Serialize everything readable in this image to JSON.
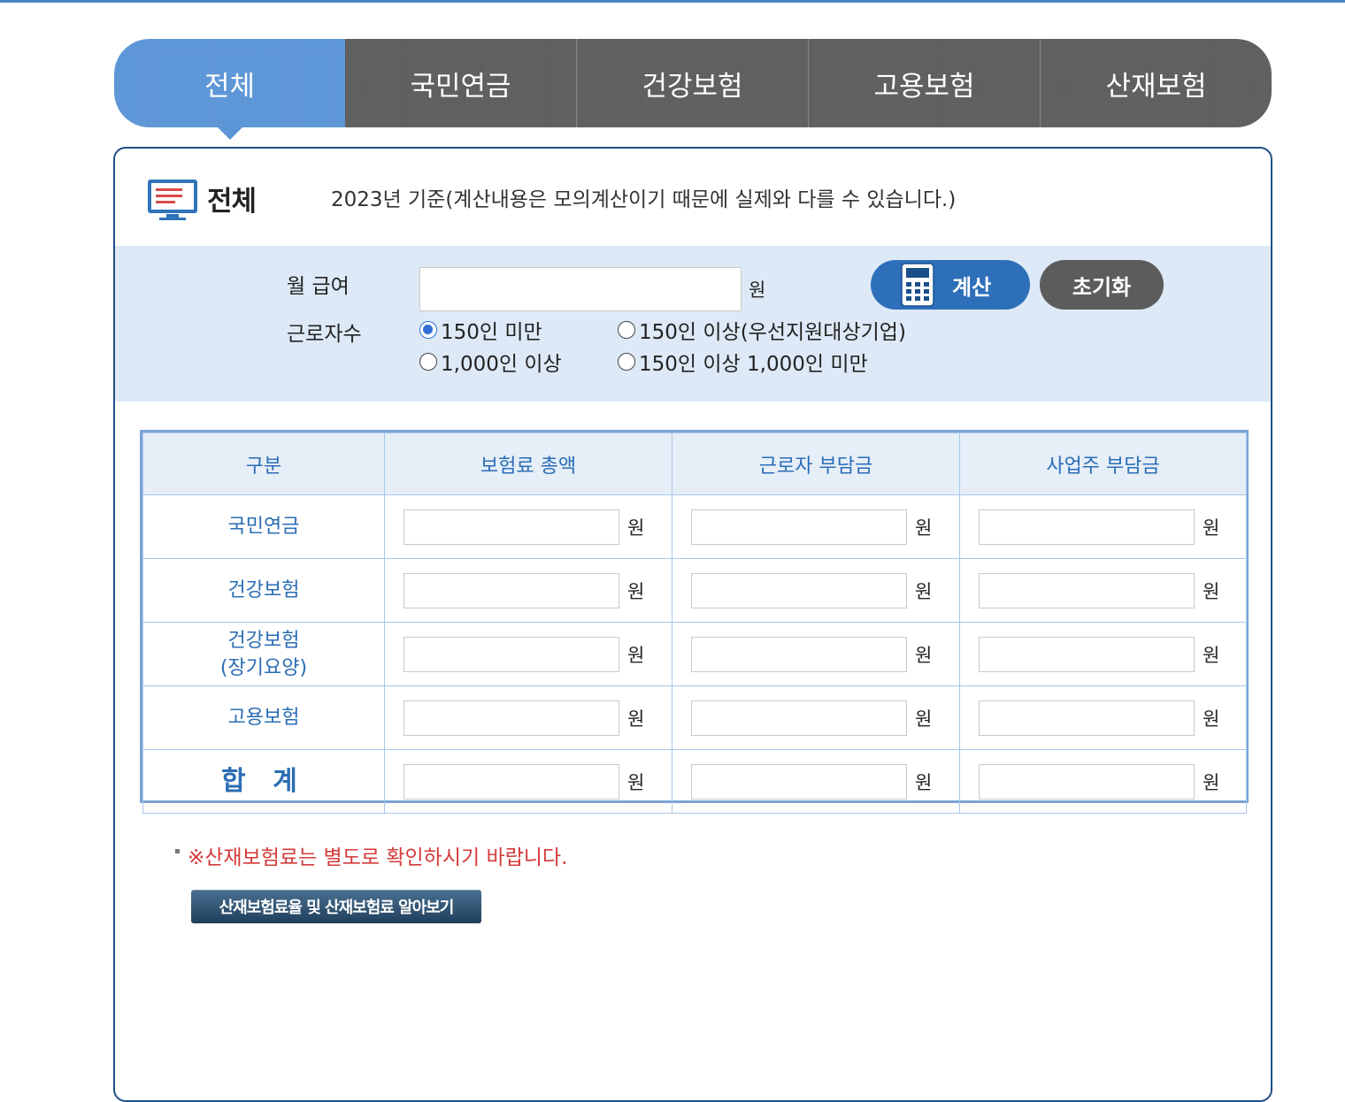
{
  "tabs": [
    {
      "label": "전체",
      "active": true
    },
    {
      "label": "국민연금",
      "active": false
    },
    {
      "label": "건강보험",
      "active": false
    },
    {
      "label": "고용보험",
      "active": false
    },
    {
      "label": "산재보험",
      "active": false
    }
  ],
  "header": {
    "title": "전체",
    "description": "2023년 기준(계산내용은 모의계산이기 때문에 실제와 다를 수 있습니다.)",
    "icon": "monitor-list-icon"
  },
  "form": {
    "salary_label": "월 급여",
    "salary_value": "",
    "salary_unit": "원",
    "workers_label": "근로자수",
    "options": [
      {
        "label": "150인 미만",
        "selected": true
      },
      {
        "label": "150인 이상(우선지원대상기업)",
        "selected": false
      },
      {
        "label": "1,000인 이상",
        "selected": false
      },
      {
        "label": "150인 이상 1,000인 미만",
        "selected": false
      }
    ],
    "calc_button": "계산",
    "reset_button": "초기화"
  },
  "table": {
    "headers": [
      "구분",
      "보험료 총액",
      "근로자 부담금",
      "사업주 부담금"
    ],
    "unit": "원",
    "rows": [
      {
        "label": "국민연금"
      },
      {
        "label": "건강보험"
      },
      {
        "label": "건강보험\n(장기요양)"
      },
      {
        "label": "고용보험"
      },
      {
        "label": "합   계"
      }
    ]
  },
  "note": "※산재보험료는 별도로 확인하시기 바랍니다.",
  "link_button": "산재보험료율 및 산재보험료 알아보기",
  "colors": {
    "accent_blue": "#5b95d6",
    "tab_gray": "#5d5d5d",
    "note_red": "#d43b3b",
    "panel_border": "#1f4f86"
  }
}
